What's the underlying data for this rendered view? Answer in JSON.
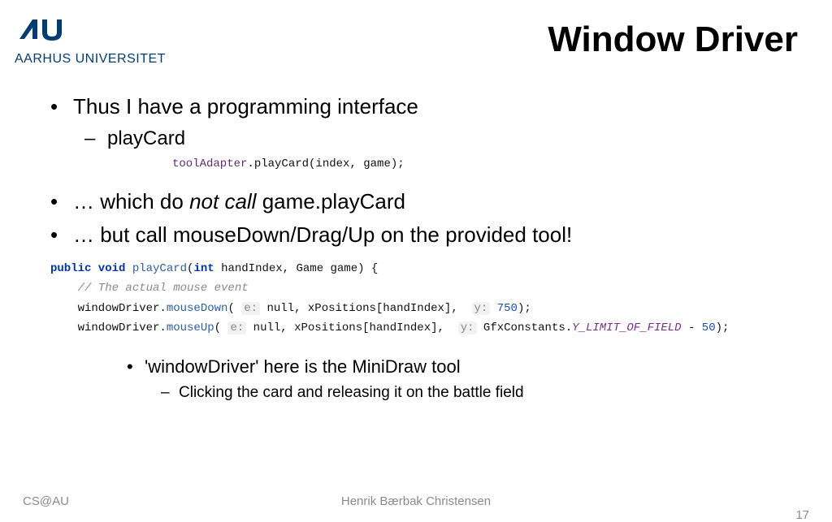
{
  "logo": {
    "text": "AARHUS UNIVERSITET"
  },
  "title": "Window Driver",
  "bullets": {
    "b1": "Thus I have a programming interface",
    "b1a": "playCard",
    "b2_pre": "… which do ",
    "b2_em": "not call",
    "b2_post": " game.playCard",
    "b3": "… but call mouseDown/Drag/Up on the provided tool!",
    "b4": "'windowDriver' here is the MiniDraw tool",
    "b4a": "Clicking the card and releasing it on the battle field"
  },
  "code1": {
    "ident": "toolAdapter",
    "rest": ".playCard(index, game);"
  },
  "code2": {
    "l1_kw1": "public void",
    "l1_name": " playCard",
    "l1_paren": "(",
    "l1_kw2": "int",
    "l1_rest": " handIndex, Game game) {",
    "l2_comment": "    // The actual mouse event",
    "l3_pre": "    windowDriver.",
    "l3_m": "mouseDown",
    "l3_mid1": "( ",
    "l3_h1": "e:",
    "l3_mid2": " null, xPositions[handIndex],  ",
    "l3_h2": "y:",
    "l3_num": " 750",
    "l3_end": ");",
    "l4_pre": "    windowDriver.",
    "l4_m": "mouseUp",
    "l4_mid1": "( ",
    "l4_h1": "e:",
    "l4_mid2": " null, xPositions[handIndex],  ",
    "l4_h2": "y:",
    "l4_mid3": " GfxConstants.",
    "l4_const": "Y_LIMIT_OF_FIELD",
    "l4_post": " - ",
    "l4_num": "50",
    "l4_end": ");"
  },
  "footer": {
    "left": "CS@AU",
    "center": "Henrik Bærbak Christensen",
    "right": "17"
  }
}
